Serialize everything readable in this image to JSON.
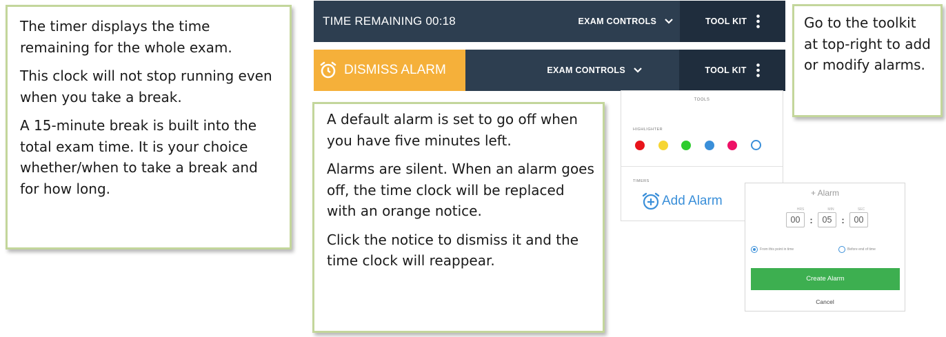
{
  "callouts": {
    "left": [
      "The timer displays the time remaining for the whole exam.",
      "This clock will not stop running even when you take a break.",
      "A 15-minute break is built into the total exam time. It is your choice whether/when to take a break and for how long."
    ],
    "middle": [
      "A default alarm is set to go off when you have five minutes left.",
      "Alarms are silent. When an alarm goes off, the time clock will be replaced with an orange notice.",
      "Click the notice to dismiss it and the time clock will reappear."
    ],
    "right": [
      "Go to the toolkit at top-right to add or modify alarms."
    ]
  },
  "toolbar_normal": {
    "timer": "TIME REMAINING 00:18",
    "exam_controls": "EXAM CONTROLS",
    "tool_kit": "TOOL KIT"
  },
  "toolbar_alarm": {
    "dismiss": "DISMISS ALARM",
    "exam_controls": "EXAM CONTROLS",
    "tool_kit": "TOOL KIT"
  },
  "tools_panel": {
    "title": "TOOLS",
    "highlighter_label": "HIGHLIGHTER",
    "highlighter_colors": [
      "#e8141b",
      "#f6d532",
      "#2ecc2e",
      "#3a8fd9",
      "#ee1166"
    ],
    "timers_label": "TIMERS",
    "add_alarm": "Add Alarm"
  },
  "alarm_dialog": {
    "title": "+ Alarm",
    "labels": [
      "HRS",
      "MIN",
      "SEC"
    ],
    "hours": "00",
    "minutes": "05",
    "seconds": "00",
    "option_from": "From this point in time",
    "option_before": "Before end of time",
    "create": "Create Alarm",
    "cancel": "Cancel"
  },
  "colors": {
    "bar": "#2d3e50",
    "toolkit": "#1f2d3d",
    "alarm_orange": "#f5b03a",
    "accent_blue": "#3a8fd9",
    "create_green": "#3daf50",
    "callout_border": "#c3d69b"
  },
  "icons": [
    "chevron-down-icon",
    "kebab-menu-icon",
    "alarm-clock-icon",
    "add-alarm-icon"
  ]
}
